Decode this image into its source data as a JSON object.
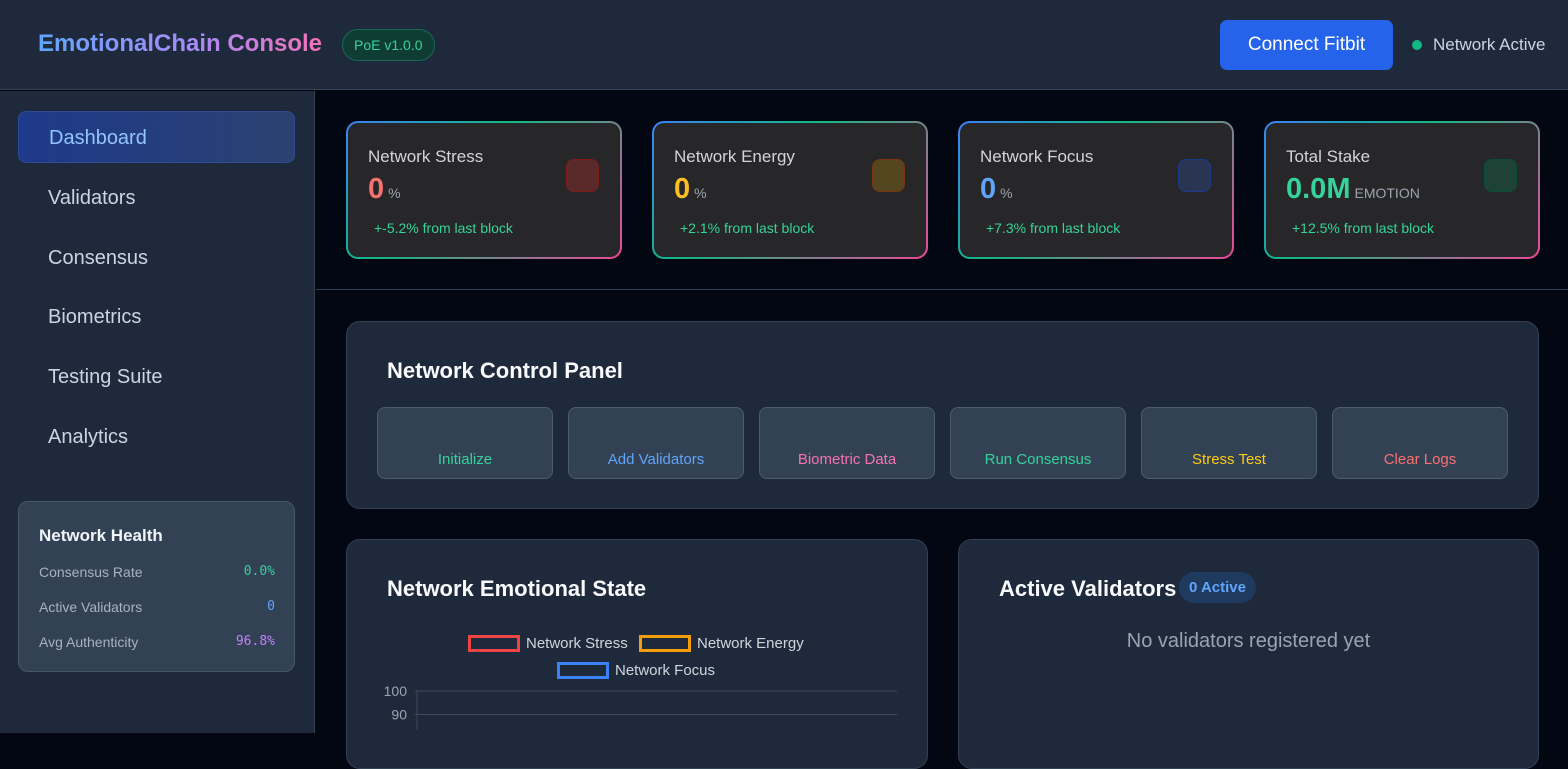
{
  "header": {
    "title": "EmotionalChain Console",
    "version_badge": "PoE v1.0.0",
    "connect_button": "Connect Fitbit",
    "network_status": "Network Active"
  },
  "sidebar": {
    "items": [
      {
        "label": "Dashboard",
        "active": true
      },
      {
        "label": "Validators",
        "active": false
      },
      {
        "label": "Consensus",
        "active": false
      },
      {
        "label": "Biometrics",
        "active": false
      },
      {
        "label": "Testing Suite",
        "active": false
      },
      {
        "label": "Analytics",
        "active": false
      }
    ],
    "health": {
      "title": "Network Health",
      "rows": [
        {
          "label": "Consensus Rate",
          "value": "0.0%",
          "color": "#34d399"
        },
        {
          "label": "Active Validators",
          "value": "0",
          "color": "#60a5fa"
        },
        {
          "label": "Avg Authenticity",
          "value": "96.8%",
          "color": "#c084fc"
        }
      ]
    }
  },
  "stats": [
    {
      "label": "Network Stress",
      "value": "0",
      "unit": "%",
      "change": "+-5.2% from last block",
      "color": "#f87171",
      "icon_color": "#7f1d1d"
    },
    {
      "label": "Network Energy",
      "value": "0",
      "unit": "%",
      "change": "+2.1% from last block",
      "color": "#fbbf24",
      "icon_color": "#78350f"
    },
    {
      "label": "Network Focus",
      "value": "0",
      "unit": "%",
      "change": "+7.3% from last block",
      "color": "#60a5fa",
      "icon_color": "#1e3a8a"
    },
    {
      "label": "Total Stake",
      "value": "0.0M",
      "unit": "EMOTION",
      "change": "+12.5% from last block",
      "color": "#34d399",
      "icon_color": "#064e3b"
    }
  ],
  "control_panel": {
    "title": "Network Control Panel",
    "buttons": [
      {
        "label": "Initialize",
        "color": "#34d399"
      },
      {
        "label": "Add Validators",
        "color": "#60a5fa"
      },
      {
        "label": "Biometric Data",
        "color": "#f472b6"
      },
      {
        "label": "Run Consensus",
        "color": "#34d399"
      },
      {
        "label": "Stress Test",
        "color": "#facc15"
      },
      {
        "label": "Clear Logs",
        "color": "#f87171"
      }
    ]
  },
  "emotional_state": {
    "title": "Network Emotional State"
  },
  "validators_panel": {
    "title": "Active Validators",
    "badge": "0 Active",
    "empty_message": "No validators registered yet"
  },
  "chart_data": {
    "type": "line",
    "title": "",
    "series": [
      {
        "name": "Network Stress",
        "color": "#ef4444",
        "values": []
      },
      {
        "name": "Network Energy",
        "color": "#f59e0b",
        "values": []
      },
      {
        "name": "Network Focus",
        "color": "#3b82f6",
        "values": []
      }
    ],
    "legend_position": "top",
    "y_ticks": [
      100,
      90
    ],
    "ylim": [
      0,
      100
    ],
    "grid": true
  }
}
